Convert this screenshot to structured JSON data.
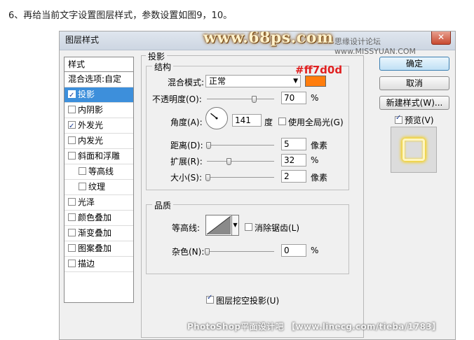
{
  "caption": "6、再给当前文字设置图层样式，参数设置如图9，10。",
  "dialog": {
    "title": "图层样式",
    "close_glyph": "✕",
    "watermark_logo": "www.68ps.com",
    "watermark_site": "思缘设计论坛  www.MISSYUAN.COM"
  },
  "styles_list": {
    "header": "样式",
    "items": [
      {
        "label": "混合选项:自定",
        "checkbox": false,
        "checked": false,
        "selected": false,
        "sub": false
      },
      {
        "label": "投影",
        "checkbox": true,
        "checked": true,
        "selected": true,
        "sub": false
      },
      {
        "label": "内阴影",
        "checkbox": true,
        "checked": false,
        "selected": false,
        "sub": false
      },
      {
        "label": "外发光",
        "checkbox": true,
        "checked": true,
        "selected": false,
        "sub": false
      },
      {
        "label": "内发光",
        "checkbox": true,
        "checked": false,
        "selected": false,
        "sub": false
      },
      {
        "label": "斜面和浮雕",
        "checkbox": true,
        "checked": false,
        "selected": false,
        "sub": false
      },
      {
        "label": "等高线",
        "checkbox": true,
        "checked": false,
        "selected": false,
        "sub": true
      },
      {
        "label": "纹理",
        "checkbox": true,
        "checked": false,
        "selected": false,
        "sub": true
      },
      {
        "label": "光泽",
        "checkbox": true,
        "checked": false,
        "selected": false,
        "sub": false
      },
      {
        "label": "颜色叠加",
        "checkbox": true,
        "checked": false,
        "selected": false,
        "sub": false
      },
      {
        "label": "渐变叠加",
        "checkbox": true,
        "checked": false,
        "selected": false,
        "sub": false
      },
      {
        "label": "图案叠加",
        "checkbox": true,
        "checked": false,
        "selected": false,
        "sub": false
      },
      {
        "label": "描边",
        "checkbox": true,
        "checked": false,
        "selected": false,
        "sub": false
      }
    ]
  },
  "drop_shadow": {
    "section_title": "投影",
    "structure_title": "结构",
    "blend_mode_label": "混合模式:",
    "blend_mode_value": "正常",
    "shadow_color": "#ff7d0d",
    "color_annotation": "#ff7d0d",
    "opacity_label": "不透明度(O):",
    "opacity_value": "70",
    "opacity_unit": "%",
    "angle_label": "角度(A):",
    "angle_value": "141",
    "angle_unit": "度",
    "global_light_label": "使用全局光(G)",
    "global_light_checked": false,
    "distance_label": "距离(D):",
    "distance_value": "5",
    "distance_unit": "像素",
    "spread_label": "扩展(R):",
    "spread_value": "32",
    "spread_unit": "%",
    "size_label": "大小(S):",
    "size_value": "2",
    "size_unit": "像素",
    "quality_title": "品质",
    "contour_label": "等高线:",
    "anti_alias_label": "消除锯齿(L)",
    "anti_alias_checked": false,
    "noise_label": "杂色(N):",
    "noise_value": "0",
    "noise_unit": "%",
    "knockout_label": "图层挖空投影(U)",
    "knockout_checked": true
  },
  "buttons": {
    "ok": "确定",
    "cancel": "取消",
    "new_style": "新建样式(W)...",
    "preview_label": "预览(V)",
    "preview_checked": true
  },
  "preview_glow_color": "#f7d00d",
  "bottom_watermark": "PhotoShop平面设计吧 【www.linecg.com/tieba/1783】"
}
